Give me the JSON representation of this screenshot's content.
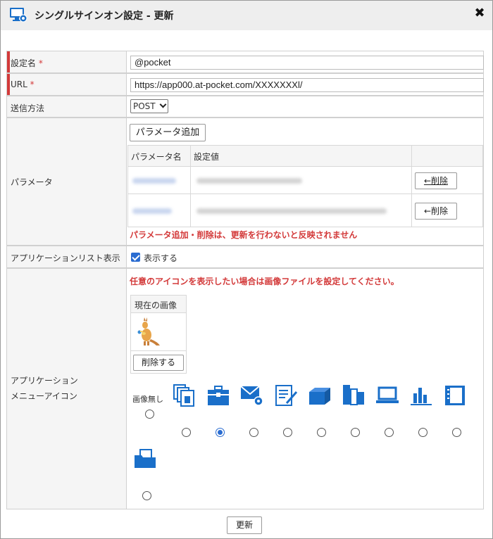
{
  "dialog": {
    "title": "シングルサインオン設定 - 更新",
    "close_glyph": "✖"
  },
  "form": {
    "name": {
      "label": "設定名",
      "required_mark": "*",
      "value": "@pocket"
    },
    "url": {
      "label": "URL",
      "required_mark": "*",
      "value": "https://app000.at-pocket.com/XXXXXXXl/"
    },
    "method": {
      "label": "送信方法",
      "selected": "POST"
    },
    "params": {
      "label": "パラメータ",
      "add_button": "パラメータ追加",
      "columns": [
        "パラメータ名",
        "設定値"
      ],
      "delete_button": "←削除",
      "rows": 2,
      "warning": "パラメータ追加・削除は、更新を行わないと反映されません"
    },
    "app_list": {
      "label": "アプリケーションリスト表示",
      "checkbox_label": "表示する",
      "checked": true
    },
    "menu_icon": {
      "label_line1": "アプリケーション",
      "label_line2": "メニューアイコン",
      "instruction": "任意のアイコンを表示したい場合は画像ファイルを設定してください。",
      "current_image_header": "現在の画像",
      "delete_button": "削除する",
      "no_image_label": "画像無し",
      "icons": [
        "documents-icon",
        "toolbox-icon",
        "mail-settings-icon",
        "document-edit-icon",
        "box-icon",
        "binders-icon",
        "laptop-icon",
        "bar-chart-icon",
        "notebook-icon",
        "folder-icon"
      ],
      "selected_index": 1
    }
  },
  "footer": {
    "update_button": "更新"
  },
  "colors": {
    "accent": "#2a6cd1",
    "required": "#d33a3a",
    "icon_blue": "#1a6fc9"
  }
}
